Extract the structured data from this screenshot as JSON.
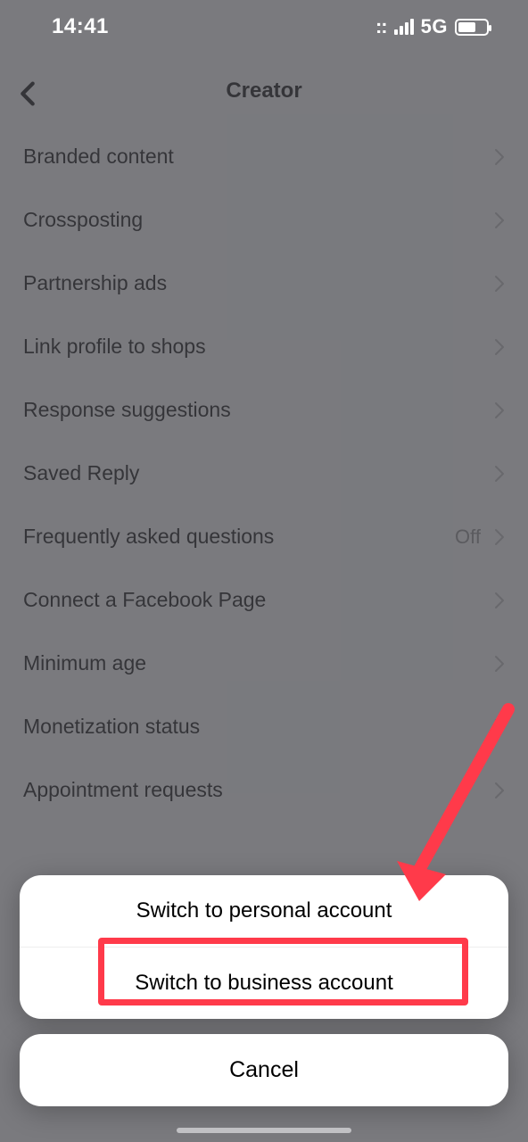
{
  "status": {
    "time": "14:41",
    "network": "5G"
  },
  "header": {
    "title": "Creator"
  },
  "rows": [
    {
      "label": "Branded content",
      "value": ""
    },
    {
      "label": "Crossposting",
      "value": ""
    },
    {
      "label": "Partnership ads",
      "value": ""
    },
    {
      "label": "Link profile to shops",
      "value": ""
    },
    {
      "label": "Response suggestions",
      "value": ""
    },
    {
      "label": "Saved Reply",
      "value": ""
    },
    {
      "label": "Frequently asked questions",
      "value": "Off"
    },
    {
      "label": "Connect a Facebook Page",
      "value": ""
    },
    {
      "label": "Minimum age",
      "value": ""
    },
    {
      "label": "Monetization status",
      "value": ""
    },
    {
      "label": "Appointment requests",
      "value": ""
    }
  ],
  "sheet": {
    "option1": "Switch to personal account",
    "option2": "Switch to business account",
    "cancel": "Cancel"
  },
  "colors": {
    "highlight": "#ff3a4a",
    "overlay": "rgba(73,74,79,0.72)"
  }
}
